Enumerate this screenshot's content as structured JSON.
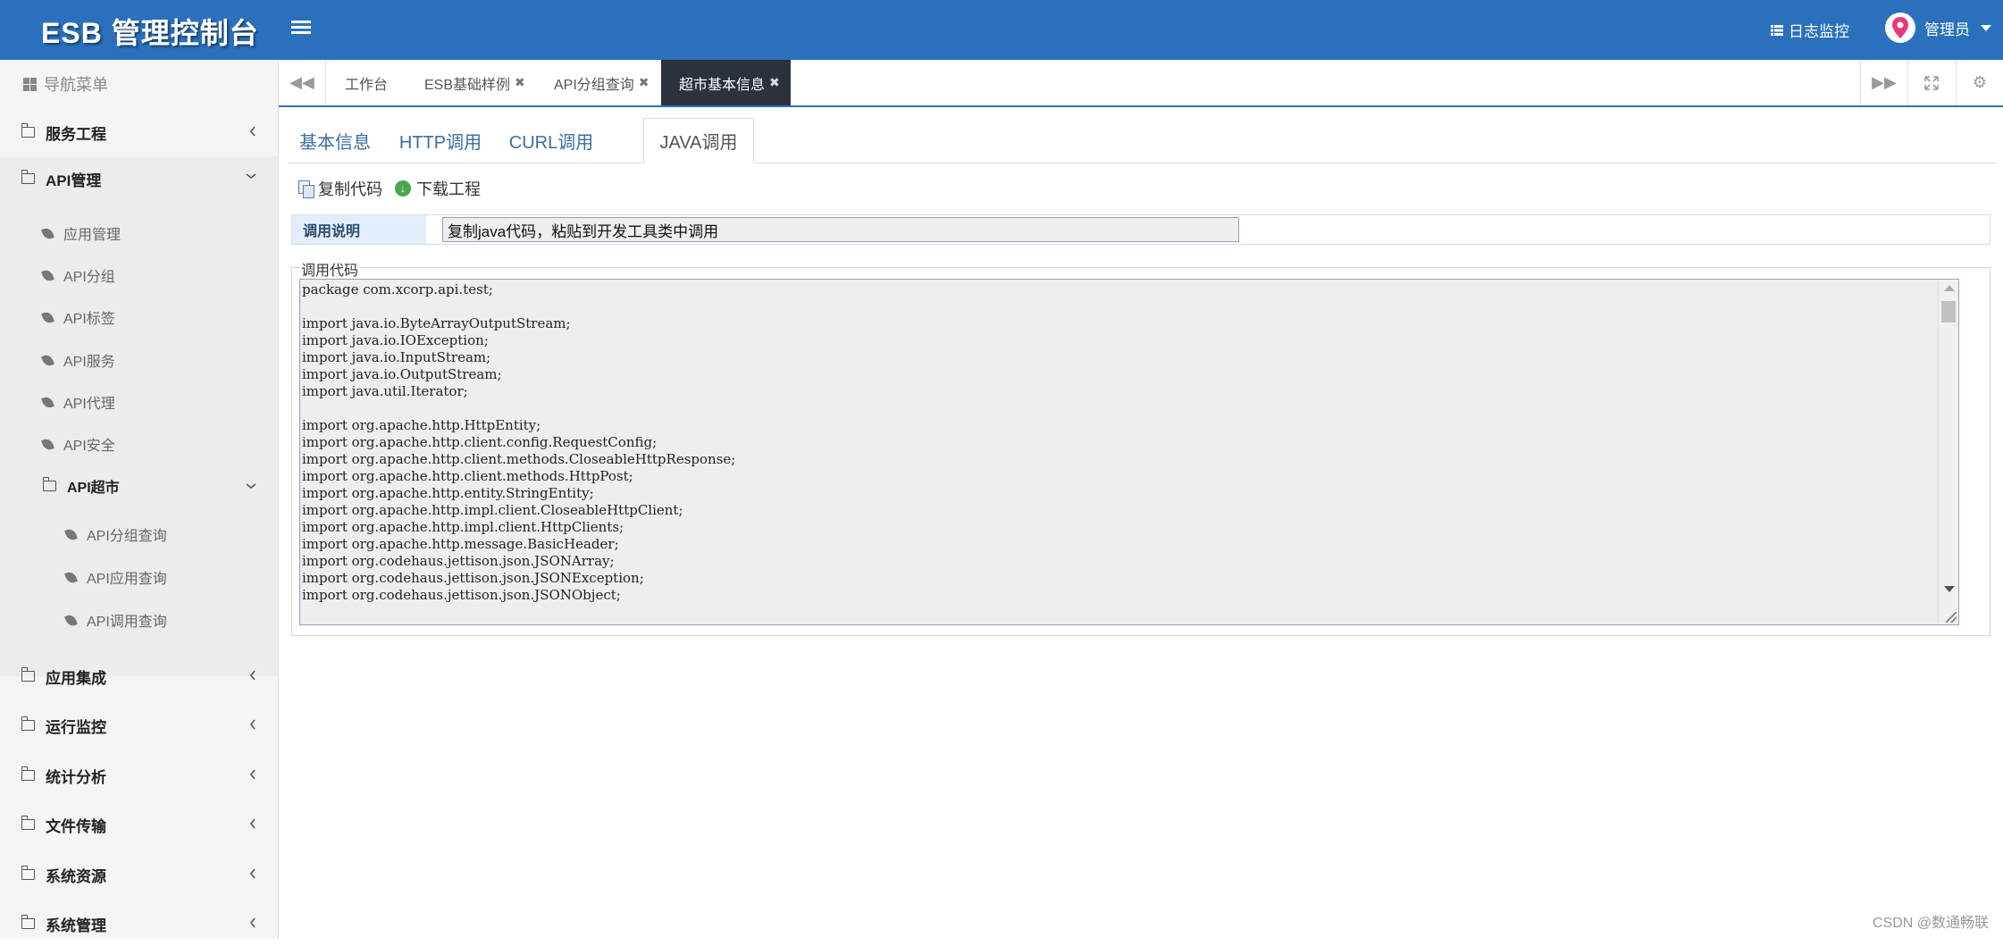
{
  "header": {
    "brand": "ESB 管理控制台",
    "log_monitor": "日志监控",
    "user": "管理员"
  },
  "sidebar": {
    "nav_title": "导航菜单",
    "items": [
      {
        "label": "服务工程"
      },
      {
        "label": "API管理"
      },
      {
        "label": "应用集成"
      },
      {
        "label": "运行监控"
      },
      {
        "label": "统计分析"
      },
      {
        "label": "文件传输"
      },
      {
        "label": "系统资源"
      },
      {
        "label": "系统管理"
      }
    ],
    "api_sub": [
      {
        "label": "应用管理"
      },
      {
        "label": "API分组"
      },
      {
        "label": "API标签"
      },
      {
        "label": "API服务"
      },
      {
        "label": "API代理"
      },
      {
        "label": "API安全"
      },
      {
        "label": "API超市"
      }
    ],
    "market_sub": [
      {
        "label": "API分组查询"
      },
      {
        "label": "API应用查询"
      },
      {
        "label": "API调用查询"
      }
    ]
  },
  "tabs": [
    {
      "label": "工作台"
    },
    {
      "label": "ESB基础样例"
    },
    {
      "label": "API分组查询"
    },
    {
      "label": "超市基本信息"
    }
  ],
  "subtabs": [
    {
      "label": "基本信息"
    },
    {
      "label": "HTTP调用"
    },
    {
      "label": "CURL调用"
    },
    {
      "label": "JAVA调用"
    }
  ],
  "toolbar": {
    "copy": "复制代码",
    "download": "下载工程"
  },
  "info": {
    "label": "调用说明",
    "value": "复制java代码，粘贴到开发工具类中调用"
  },
  "code_section": {
    "legend": "调用代码",
    "code": "package com.xcorp.api.test;\n\nimport java.io.ByteArrayOutputStream;\nimport java.io.IOException;\nimport java.io.InputStream;\nimport java.io.OutputStream;\nimport java.util.Iterator;\n\nimport org.apache.http.HttpEntity;\nimport org.apache.http.client.config.RequestConfig;\nimport org.apache.http.client.methods.CloseableHttpResponse;\nimport org.apache.http.client.methods.HttpPost;\nimport org.apache.http.entity.StringEntity;\nimport org.apache.http.impl.client.CloseableHttpClient;\nimport org.apache.http.impl.client.HttpClients;\nimport org.apache.http.message.BasicHeader;\nimport org.codehaus.jettison.json.JSONArray;\nimport org.codehaus.jettison.json.JSONException;\nimport org.codehaus.jettison.json.JSONObject;"
  },
  "watermark": "CSDN @数通畅联",
  "colors": {
    "header_bg": "#2a70bd",
    "active_tab_bg": "#2b323b",
    "subtab_link": "#3a6f9e",
    "avatar_pin": "#e6397a"
  }
}
